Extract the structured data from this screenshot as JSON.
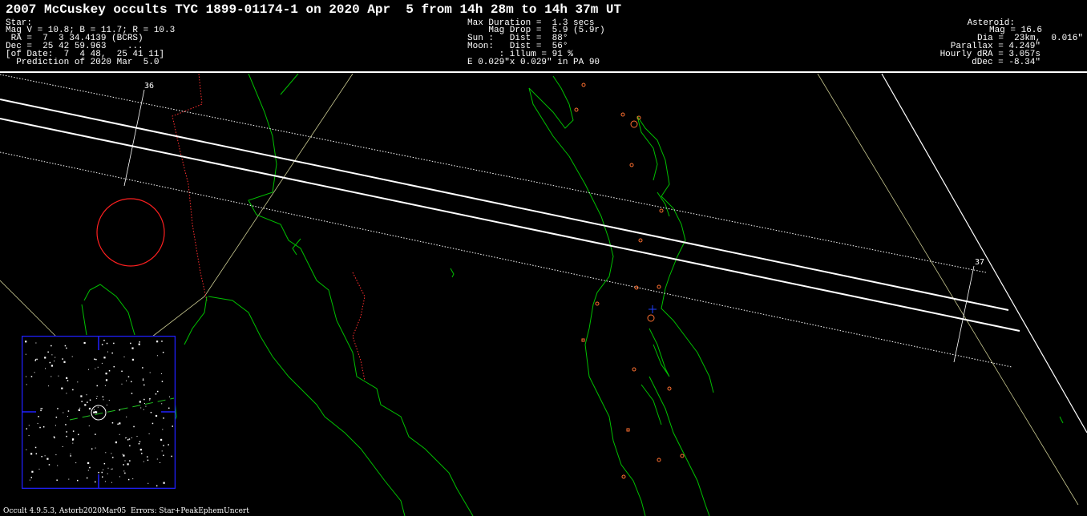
{
  "header": {
    "title": "2007 McCuskey occults TYC 1899-01174-1 on 2020 Apr  5 from 14h 28m to 14h 37m UT",
    "star": {
      "label": "Star:",
      "mag_line": "Mag V = 10.8; B = 11.7; R = 10.3",
      "ra_line": " RA =  7  3 34.4139 (BCRS)",
      "dec_line": "Dec =  25 42 59.963    ...",
      "of_date_line": "[of Date:  7  4 48,  25 41 11]",
      "prediction_line": "  Prediction of 2020 Mar  5.0"
    },
    "event": {
      "max_duration_line": "Max Duration =  1.3 secs",
      "mag_drop_line": "    Mag Drop =  5.9 (5.9r)",
      "sun_line": "Sun :   Dist =  88°",
      "moon_line": "Moon:   Dist =  56°",
      "illum_line": "      : illum = 91 %",
      "ellipse_line": "E 0.029\"x 0.029\" in PA 90"
    },
    "asteroid": {
      "label": "Asteroid:",
      "mag_line": "Mag = 16.6",
      "dia_line": "Dia =  23km,  0.016\"",
      "parallax_line": "Parallax = 4.249\"",
      "hourly_dra_line": "Hourly dRA = 3.057s",
      "ddec_line": "dDec = -8.34\""
    }
  },
  "map": {
    "time_labels": [
      "36",
      "37"
    ],
    "colors": {
      "background": "#000000",
      "coastline": "#00c000",
      "border": "#ff3030",
      "path": "#ffffff",
      "sites": "#ff7030",
      "finder_frame": "#2020ff",
      "graticule": "#c8c890"
    }
  },
  "footer": {
    "text": "Occult 4.9.5.3, Astorb2020Mar05  Errors: Star+PeakEphemUncert"
  }
}
